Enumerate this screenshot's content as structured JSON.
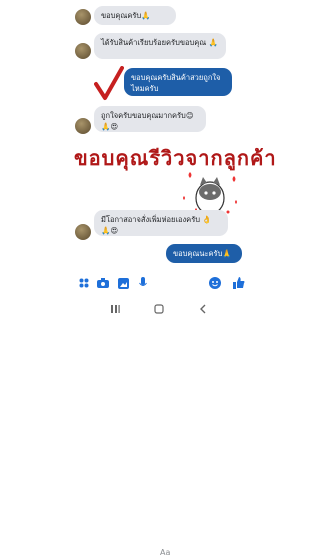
{
  "messages": [
    {
      "side": "in",
      "text": "ขอบคุณครับ🙏"
    },
    {
      "side": "in",
      "text": "ได้รับสินค้าเรียบร้อยครับขอบคุณ 🙏"
    },
    {
      "side": "out",
      "text": "ขอบคุณครับสินค้าสวยถูกใจไหมครับ"
    },
    {
      "side": "in",
      "text": "ถูกใจครับขอบคุณมากครับ😊🙏😍"
    },
    {
      "side": "in",
      "text": "มีโอกาสอาจสั่งเพิ่มห่อยเองครับ 👌🙏😍"
    },
    {
      "side": "out",
      "text": "ขอบคุณนะครับ🙏"
    }
  ],
  "overlay_text": "ขอบคุณรีวิวจากลูกค้า",
  "composer": {
    "placeholder": "Aa"
  },
  "colors": {
    "accent": "#1e6fd9",
    "outgoing": "#1e5ea8",
    "incoming": "#e4e6eb",
    "overlay": "#b01818"
  }
}
